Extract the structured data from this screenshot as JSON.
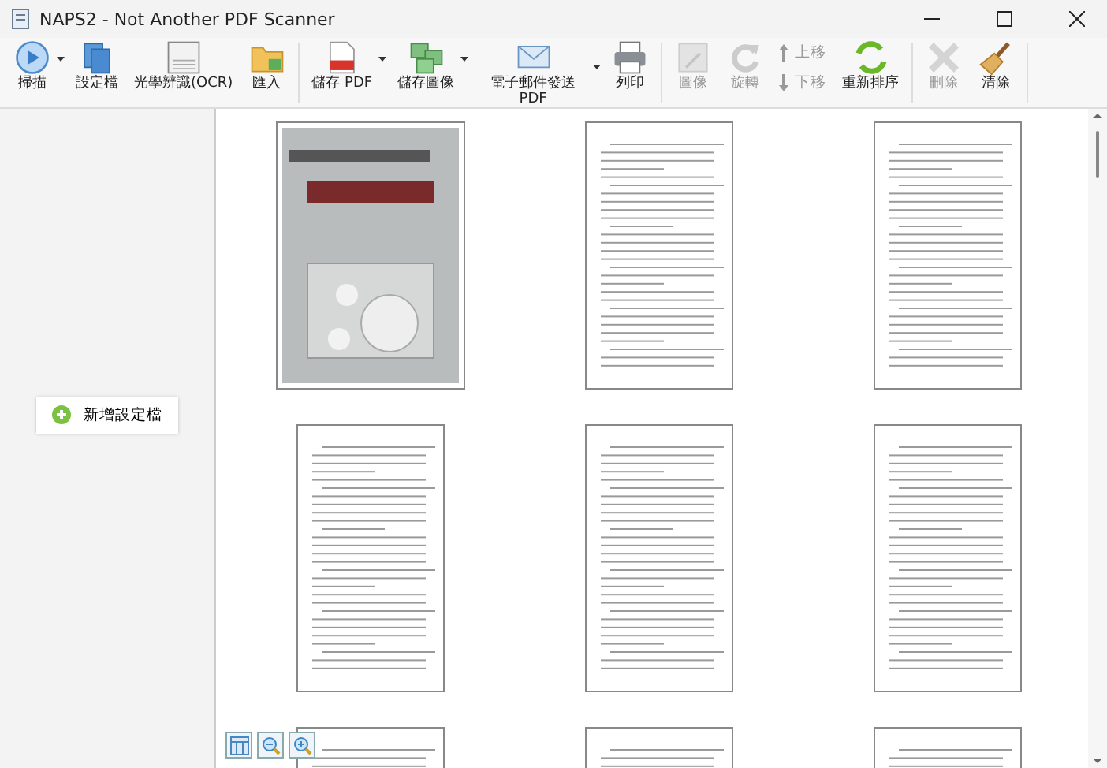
{
  "window": {
    "title": "NAPS2 - Not Another PDF Scanner"
  },
  "toolbar": {
    "groups": [
      [
        {
          "kind": "large",
          "label": "掃描",
          "dropdown": true,
          "disabled": false
        },
        {
          "kind": "large",
          "label": "設定檔",
          "dropdown": false,
          "disabled": false
        },
        {
          "kind": "large",
          "label": "光學辨識(OCR)",
          "dropdown": false,
          "disabled": false
        },
        {
          "kind": "large",
          "label": "匯入",
          "dropdown": false,
          "disabled": false
        }
      ],
      [
        {
          "kind": "large",
          "label": "儲存 PDF",
          "dropdown": true,
          "disabled": false
        },
        {
          "kind": "large",
          "label": "儲存圖像",
          "dropdown": true,
          "disabled": false
        },
        {
          "kind": "large",
          "label": "電子郵件發送 PDF",
          "dropdown": true,
          "disabled": false
        },
        {
          "kind": "large",
          "label": "列印",
          "dropdown": false,
          "disabled": false
        }
      ],
      [
        {
          "kind": "large",
          "label": "圖像",
          "dropdown": false,
          "disabled": true
        },
        {
          "kind": "large",
          "label": "旋轉",
          "dropdown": false,
          "disabled": true
        },
        {
          "kind": "pair",
          "labels": [
            "上移",
            "下移"
          ],
          "disabled": true
        },
        {
          "kind": "large",
          "label": "重新排序",
          "dropdown": false,
          "disabled": false
        }
      ],
      [
        {
          "kind": "large",
          "label": "刪除",
          "dropdown": false,
          "disabled": true
        },
        {
          "kind": "large",
          "label": "清除",
          "dropdown": false,
          "disabled": false
        }
      ]
    ]
  },
  "sidebar": {
    "add_profile_button": "新增設定檔"
  },
  "thumbnails": [
    {
      "kind": "cover"
    },
    {
      "kind": "page"
    },
    {
      "kind": "page"
    },
    {
      "kind": "page"
    },
    {
      "kind": "page"
    },
    {
      "kind": "page"
    },
    {
      "kind": "page"
    },
    {
      "kind": "page"
    },
    {
      "kind": "page"
    }
  ]
}
